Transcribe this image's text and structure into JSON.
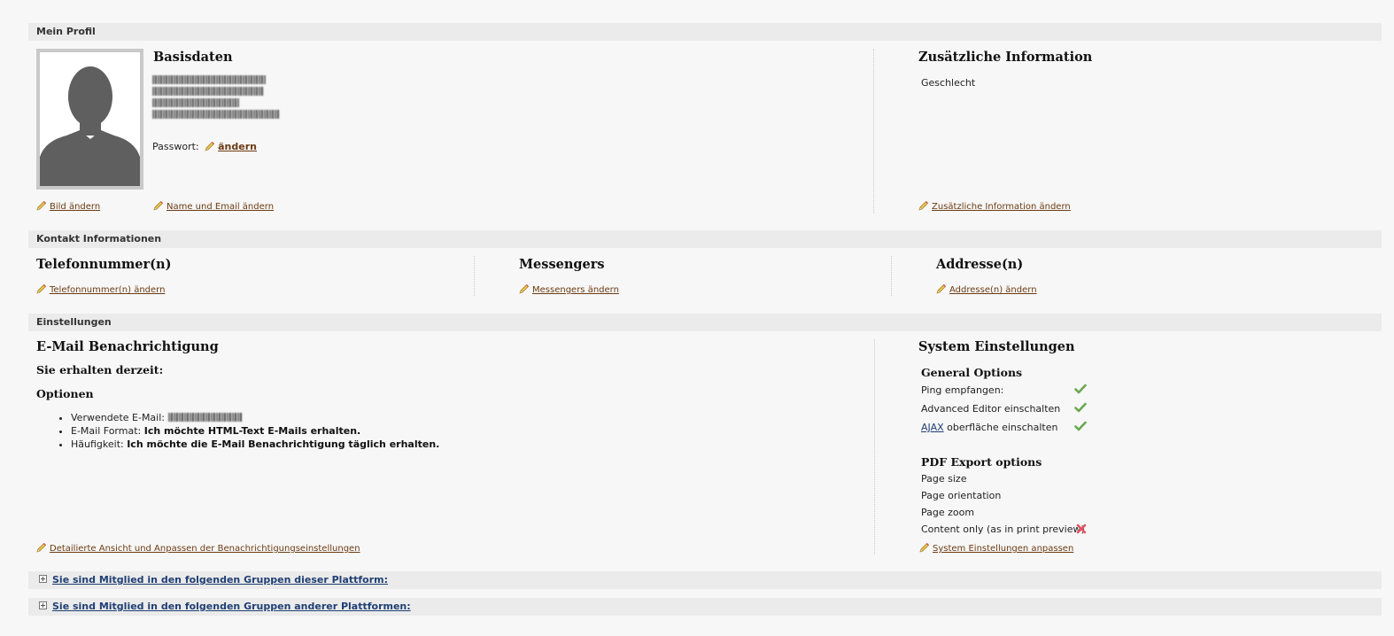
{
  "profile": {
    "section_title": "Mein Profil",
    "basic_title": "Basisdaten",
    "password_label": "Passwort:",
    "password_change": "ändern",
    "change_picture": "Bild ändern",
    "change_name_email": "Name und Email ändern",
    "extra_title": "Zusätzliche Information",
    "gender_label": "Geschlecht",
    "change_extra": "Zusätzliche Information ändern"
  },
  "contact": {
    "section_title": "Kontakt Informationen",
    "phone_title": "Telefonnummer(n)",
    "phone_change": "Telefonnummer(n) ändern",
    "messengers_title": "Messengers",
    "messengers_change": "Messengers ändern",
    "address_title": "Addresse(n)",
    "address_change": "Addresse(n) ändern"
  },
  "settings": {
    "section_title": "Einstellungen",
    "email_title": "E-Mail Benachrichtigung",
    "current_label": "Sie erhalten derzeit:",
    "options_title": "Optionen",
    "used_email_label": "Verwendete E-Mail:",
    "format_label": "E-Mail Format:",
    "format_value": "Ich möchte HTML-Text E-Mails erhalten.",
    "frequency_label": "Häufigkeit:",
    "frequency_value": "Ich möchte die E-Mail Benachrichtigung täglich erhalten.",
    "detail_link": "Detailierte Ansicht und Anpassen der Benachrichtigungseinstellungen",
    "system_title": "System Einstellungen",
    "general_title": "General Options",
    "ping_label": "Ping empfangen:",
    "editor_label": "Advanced Editor einschalten",
    "ajax_link": "AJAX",
    "ajax_rest": " oberfläche einschalten",
    "pdf_title": "PDF Export options",
    "page_size": "Page size",
    "page_orientation": "Page orientation",
    "page_zoom": "Page zoom",
    "content_only": "Content only (as in print preview)",
    "system_change": "System Einstellungen anpassen"
  },
  "groups": {
    "this_platform": "Sie sind Mitglied in den folgenden Gruppen dieser Plattform:",
    "other_platforms": "Sie sind Mitglied in den folgenden Gruppen anderer Plattformen:"
  },
  "colors": {
    "check": "#6aa84f",
    "cross": "#e05561",
    "link": "#6b3b12",
    "group_link": "#1f3f73"
  },
  "icons": [
    "pencil-icon",
    "check-icon",
    "cross-icon",
    "expand-icon",
    "avatar-silhouette"
  ]
}
